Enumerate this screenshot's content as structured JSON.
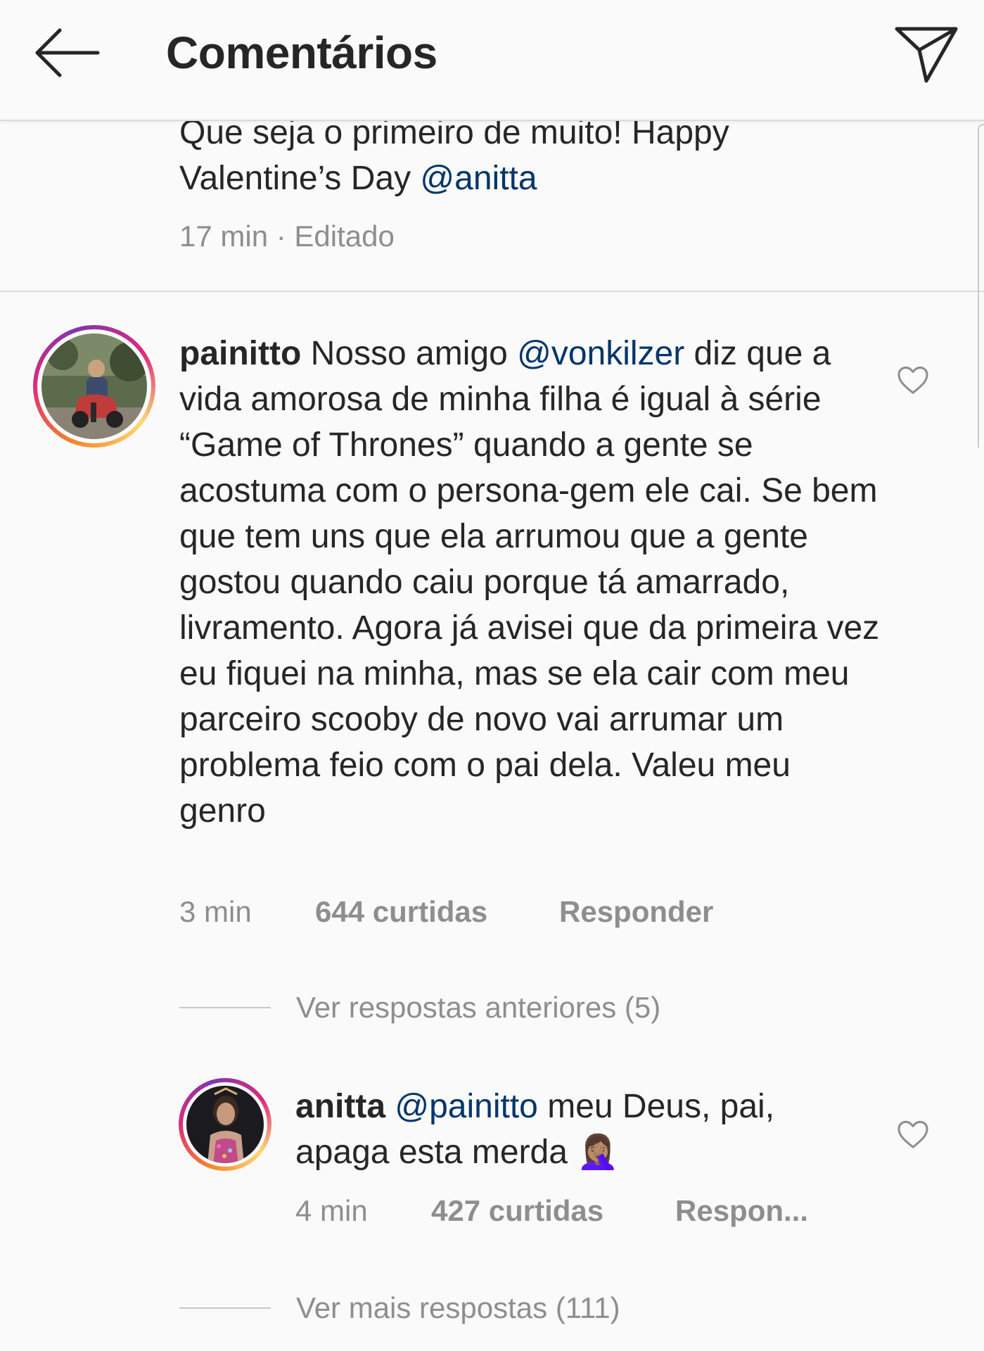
{
  "header": {
    "title": "Comentários",
    "back_icon": "arrow-left-icon",
    "direct_icon": "paper-plane-icon"
  },
  "caption": {
    "text_1": "Que seja o primeiro de muito! Happy Valentine’s Day ",
    "mention": "@anitta",
    "time": "17 min",
    "separator": " · ",
    "edited": "Editado"
  },
  "comments": [
    {
      "username": "painitto",
      "text_before": " Nosso amigo ",
      "mention": "@vonkilzer",
      "text_after": " diz que a vida amorosa de minha filha é igual à série “Game of Thrones” quando a gente se acostuma com o persona-gem ele cai. Se bem que tem uns que ela arrumou que a gente gostou quando caiu porque tá amarrado, livramento. Agora já avisei que da primeira vez eu fiquei na minha, mas se ela cair com meu parceiro scooby de novo vai arrumar um problema feio com o pai dela. Valeu meu genro",
      "time": "3 min",
      "likes": "644 curtidas",
      "reply": "Responder",
      "view_replies": "Ver respostas anteriores (5)"
    },
    {
      "username": "anitta",
      "mention": "@painitto",
      "text_after": " meu Deus, pai, apaga esta merda ",
      "emoji": "🤦🏽‍♀️",
      "time": "4 min",
      "likes": "427 curtidas",
      "reply": "Respon...",
      "view_more": "Ver mais respostas (111)"
    }
  ],
  "colors": {
    "background": "#fafafa",
    "text": "#262626",
    "secondary": "#8e8e8e",
    "mention": "#003569",
    "divider": "#dbdbdb"
  }
}
